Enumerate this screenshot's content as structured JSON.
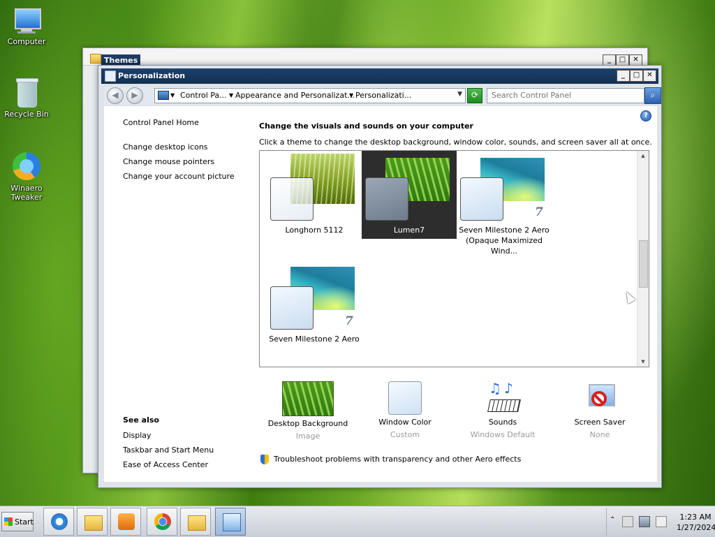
{
  "desktop": {
    "icons": [
      {
        "label": "Computer"
      },
      {
        "label": "Recycle Bin"
      },
      {
        "label": "Winaero Tweaker"
      }
    ]
  },
  "themes_window": {
    "title": "Themes"
  },
  "window": {
    "title": "Personalization",
    "address": {
      "crumbs": [
        "Control Pa...",
        "Appearance and Personalizat...",
        "Personalizati..."
      ]
    },
    "search": {
      "placeholder": "Search Control Panel"
    },
    "sidebar": {
      "home": "Control Panel Home",
      "links": [
        "Change desktop icons",
        "Change mouse pointers",
        "Change your account picture"
      ],
      "see_also_heading": "See also",
      "see_also": [
        "Display",
        "Taskbar and Start Menu",
        "Ease of Access Center"
      ]
    },
    "heading": "Change the visuals and sounds on your computer",
    "subheading": "Click a theme to change the desktop background, window color, sounds, and screen saver all at once.",
    "themes": [
      {
        "name": "Longhorn 5112",
        "selected": false
      },
      {
        "name": "Lumen7",
        "selected": true
      },
      {
        "name": "Seven Milestone 2 Aero (Opaque Maximized Wind...",
        "selected": false
      },
      {
        "name": "Seven Milestone 2 Aero",
        "selected": false
      }
    ],
    "settings": [
      {
        "label": "Desktop Background",
        "value": "Image"
      },
      {
        "label": "Window Color",
        "value": "Custom"
      },
      {
        "label": "Sounds",
        "value": "Windows Default"
      },
      {
        "label": "Screen Saver",
        "value": "None"
      }
    ],
    "troubleshoot": "Troubleshoot problems with transparency and other Aero effects"
  },
  "taskbar": {
    "start_label": "Start",
    "clock_time": "1:23 AM",
    "clock_date": "1/27/2024"
  }
}
